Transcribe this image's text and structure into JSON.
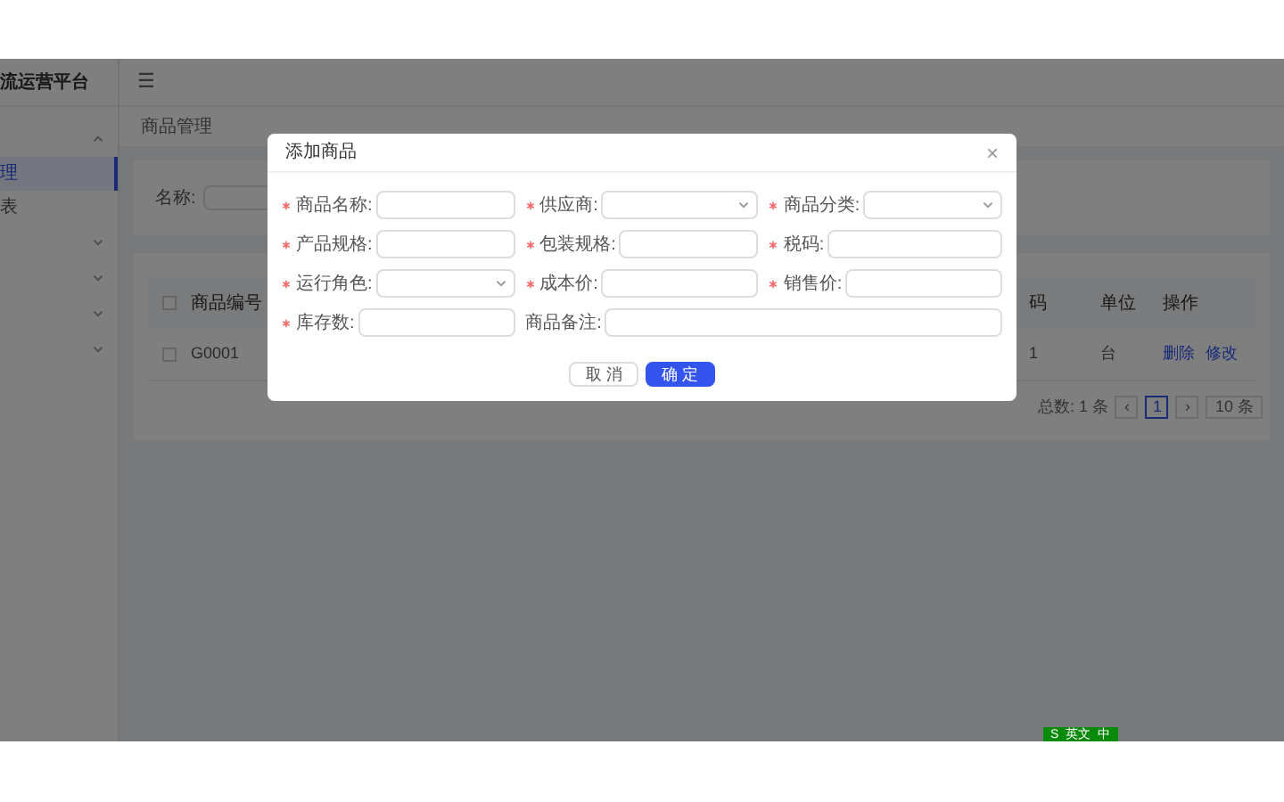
{
  "app": {
    "title": "流运营平台",
    "menu_toggle": "☰"
  },
  "sidebar": {
    "items": [
      {
        "kind": "group",
        "expanded": true
      },
      {
        "kind": "item",
        "label": "理",
        "selected": true
      },
      {
        "kind": "item",
        "label": "表",
        "selected": false
      },
      {
        "kind": "group",
        "expanded": false
      },
      {
        "kind": "group",
        "expanded": false
      },
      {
        "kind": "group",
        "expanded": false
      },
      {
        "kind": "group",
        "expanded": false
      }
    ]
  },
  "breadcrumb": "商品管理",
  "filter": {
    "label": "名称:"
  },
  "table": {
    "select_all_checked": false,
    "columns": [
      "商品编号",
      "码",
      "单位",
      "操作"
    ],
    "rows": [
      {
        "checked": false,
        "cells": [
          "G0001",
          "1",
          "台"
        ],
        "actions": [
          "删除",
          "修改"
        ]
      }
    ]
  },
  "pagination": {
    "total": "总数: 1 条",
    "pages": [
      {
        "label": "1",
        "selected": true
      }
    ],
    "prev": "‹",
    "next": "›",
    "page_size": "10 条"
  },
  "dialog": {
    "title": "添加商品",
    "close": "×",
    "fields": [
      {
        "kind": "text",
        "label": "商品名称:",
        "required": true
      },
      {
        "kind": "select",
        "label": "供应商:",
        "required": true
      },
      {
        "kind": "select",
        "label": "商品分类:",
        "required": true
      },
      {
        "kind": "text",
        "label": "产品规格:",
        "required": true
      },
      {
        "kind": "text",
        "label": "包装规格:",
        "required": true
      },
      {
        "kind": "text",
        "label": "税码:",
        "required": true
      },
      {
        "kind": "select",
        "label": "运行角色:",
        "required": true
      },
      {
        "kind": "text",
        "label": "成本价:",
        "required": true
      },
      {
        "kind": "text",
        "label": "销售价:",
        "required": true
      },
      {
        "kind": "text",
        "label": "库存数:",
        "required": true
      },
      {
        "kind": "textarea",
        "label": "商品备注:",
        "required": false
      }
    ],
    "buttons": [
      {
        "label": "取 消",
        "primary": false
      },
      {
        "label": "确 定",
        "primary": true
      }
    ]
  },
  "ime_bar": [
    "S",
    "英文",
    "中"
  ]
}
